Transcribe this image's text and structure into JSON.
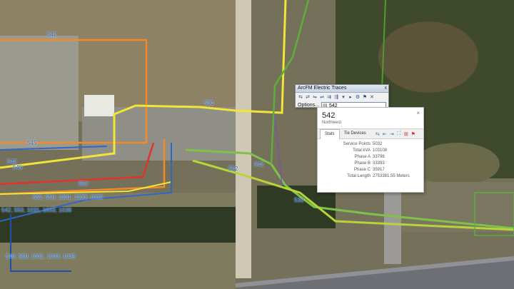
{
  "map": {
    "labels": [
      "542",
      "530",
      "545",
      "542",
      "552",
      "552",
      "542",
      "530",
      "545",
      "552, 550, 1031, 1033, 1035",
      "542, 550, 1031, 1033, 1038",
      "546, 550, 1031, 1033, 1039"
    ],
    "colors": {
      "line_yellow": "#f1e53a",
      "line_orange": "#f28a2a",
      "line_red": "#e2332a",
      "line_green": "#7fc24a",
      "line_lime": "#b7d43a",
      "line_blue": "#2f66c8",
      "line_darkblue": "#1f4fa8"
    }
  },
  "toolbar": {
    "title": "ArcFM Electric Traces",
    "close_glyph": "x",
    "icons": [
      "trace-upstream-icon",
      "trace-downstream-icon",
      "trace-isolate-icon",
      "trace-protective-icon",
      "trace-feeder-icon",
      "trace-phase-icon",
      "dropdown-icon",
      "arrow-icon",
      "settings-icon",
      "flag-icon",
      "clear-icon"
    ],
    "options_label": "Options...",
    "feeder_value": "542"
  },
  "popup": {
    "title": "542",
    "subtitle": "Northwest",
    "close_glyph": "×",
    "tabs": [
      "Stats",
      "Tie Devices"
    ],
    "tool_icons": [
      "trace-icon",
      "upstream-icon",
      "downstream-icon",
      "zoom-extent-icon",
      "select-icon",
      "flag-icon"
    ],
    "stats": [
      {
        "label": "Service Points",
        "value": "5032"
      },
      {
        "label": "Total kVA",
        "value": "103108"
      },
      {
        "label": "Phase A",
        "value": "33798"
      },
      {
        "label": "Phase B",
        "value": "33393"
      },
      {
        "label": "Phase C",
        "value": "35917"
      },
      {
        "label": "Total Length",
        "value": "2753381.55 Meters"
      }
    ]
  }
}
